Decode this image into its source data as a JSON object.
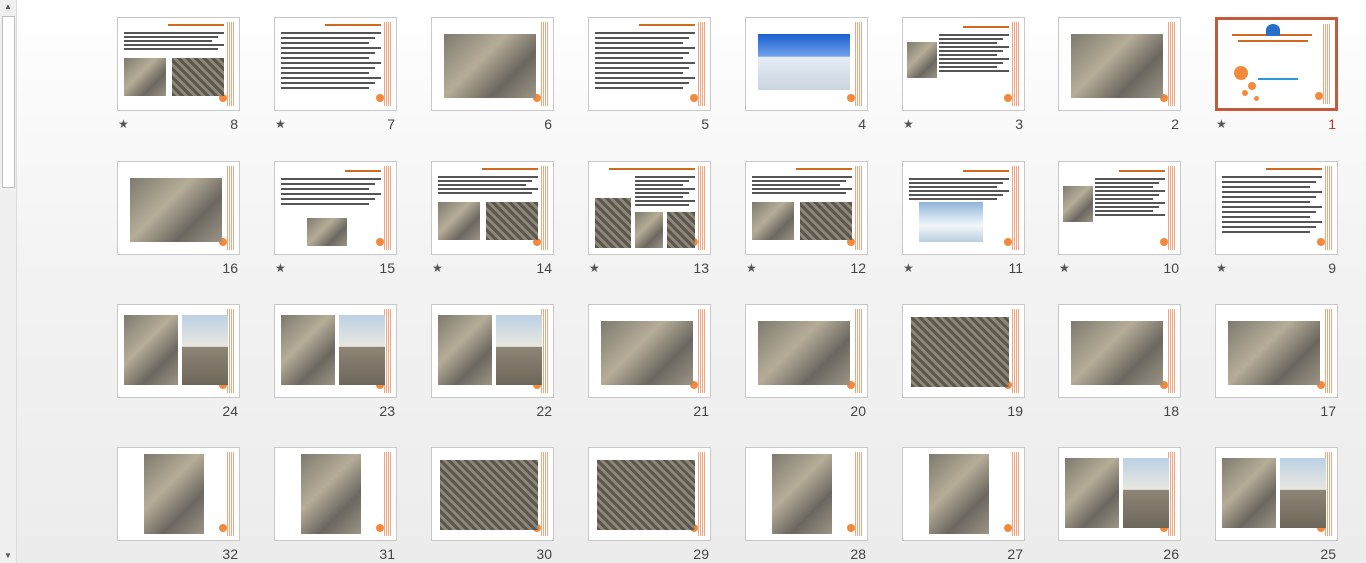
{
  "scrollbar": {
    "up": "▲",
    "down": "▼"
  },
  "transition_mark": "★",
  "selected_slide": "1",
  "slides": [
    {
      "number": "1",
      "star": true,
      "kind": "title"
    },
    {
      "number": "2",
      "star": false,
      "kind": "photo"
    },
    {
      "number": "3",
      "star": true,
      "kind": "text-photo"
    },
    {
      "number": "4",
      "star": false,
      "kind": "photo-blue"
    },
    {
      "number": "5",
      "star": false,
      "kind": "text"
    },
    {
      "number": "6",
      "star": false,
      "kind": "photo"
    },
    {
      "number": "7",
      "star": true,
      "kind": "text"
    },
    {
      "number": "8",
      "star": true,
      "kind": "text-photo2"
    },
    {
      "number": "9",
      "star": true,
      "kind": "text"
    },
    {
      "number": "10",
      "star": true,
      "kind": "text-photo"
    },
    {
      "number": "11",
      "star": true,
      "kind": "text-snow"
    },
    {
      "number": "12",
      "star": true,
      "kind": "text-photo2"
    },
    {
      "number": "13",
      "star": true,
      "kind": "text-photo3"
    },
    {
      "number": "14",
      "star": true,
      "kind": "text-photo2"
    },
    {
      "number": "15",
      "star": true,
      "kind": "text-small"
    },
    {
      "number": "16",
      "star": false,
      "kind": "photo"
    },
    {
      "number": "17",
      "star": false,
      "kind": "photo"
    },
    {
      "number": "18",
      "star": false,
      "kind": "photo"
    },
    {
      "number": "19",
      "star": false,
      "kind": "photo-rebar"
    },
    {
      "number": "20",
      "star": false,
      "kind": "photo"
    },
    {
      "number": "21",
      "star": false,
      "kind": "photo"
    },
    {
      "number": "22",
      "star": false,
      "kind": "photo2"
    },
    {
      "number": "23",
      "star": false,
      "kind": "photo2"
    },
    {
      "number": "24",
      "star": false,
      "kind": "photo2"
    },
    {
      "number": "25",
      "star": false,
      "kind": "photo2"
    },
    {
      "number": "26",
      "star": false,
      "kind": "photo2"
    },
    {
      "number": "27",
      "star": false,
      "kind": "photo-tall"
    },
    {
      "number": "28",
      "star": false,
      "kind": "photo-tall"
    },
    {
      "number": "29",
      "star": false,
      "kind": "photo-rebar"
    },
    {
      "number": "30",
      "star": false,
      "kind": "photo-rebar"
    },
    {
      "number": "31",
      "star": false,
      "kind": "photo-tall"
    },
    {
      "number": "32",
      "star": false,
      "kind": "photo-tall"
    }
  ],
  "colors": {
    "accent": "#f4893c",
    "selection": "#c55a3a",
    "text": "#444444"
  }
}
